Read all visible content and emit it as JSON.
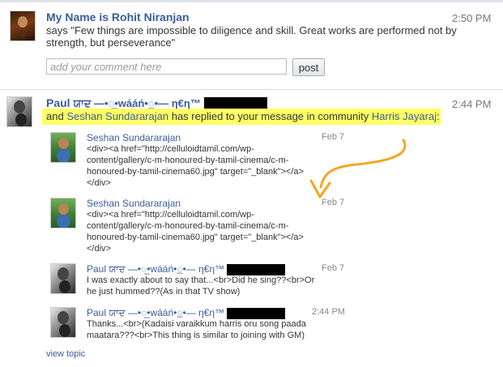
{
  "story1": {
    "author": "My Name is Rohit Niranjan",
    "time": "2:50 PM",
    "status": "says \"Few things are impossible to diligence and skill. Great works are performed not by strength, but perseverance\"",
    "comment_placeholder": "add your comment here",
    "post_label": "post"
  },
  "story2": {
    "author_name": "Paul",
    "author_decoration": "ਯਾਦ —•◌̲•wááń•◌̲•— η€η™",
    "time": "2:44 PM",
    "activity": {
      "prefix": "and",
      "replier": "Seshan Sundararajan",
      "middle": "has replied to your message in community",
      "community": "Harris Jayaraj",
      "suffix": ":"
    },
    "replies": [
      {
        "author": "Seshan Sundararajan",
        "date": "Feb 7",
        "text": "<div><a href=\"http://celluloidtamil.com/wp-content/gallery/c-m-honoured-by-tamil-cinema/c-m-honoured-by-tamil-cinema60.jpg\" target=\"_blank\"></a></div>"
      },
      {
        "author": "Seshan Sundararajan",
        "date": "Feb 7",
        "text": "<div><a href=\"http://celluloidtamil.com/wp-content/gallery/c-m-honoured-by-tamil-cinema/c-m-honoured-by-tamil-cinema60.jpg\" target=\"_blank\"></a></div>"
      },
      {
        "author": "Paul",
        "decoration": "ਯਾਦ —•◌̲•wááń•◌̲•— η€η™",
        "date": "Feb 7",
        "text": "I was exactly about to say that...<br>Did he sing??<br>Or he just hummed??(As in that TV show)"
      },
      {
        "author": "Paul",
        "decoration": "ਯਾਦ —•◌̲•wááń•◌̲•— η€η™",
        "date": "2:44 PM",
        "text": "Thanks...<br>(Kadaisi varaikkum harris oru song paada maatara???<br>This thing is similar to joining with GM)"
      }
    ],
    "view_topic": "view topic"
  },
  "colors": {
    "link": "#3b5d9a",
    "highlight": "#ffff66",
    "arrow": "#f5a623"
  }
}
